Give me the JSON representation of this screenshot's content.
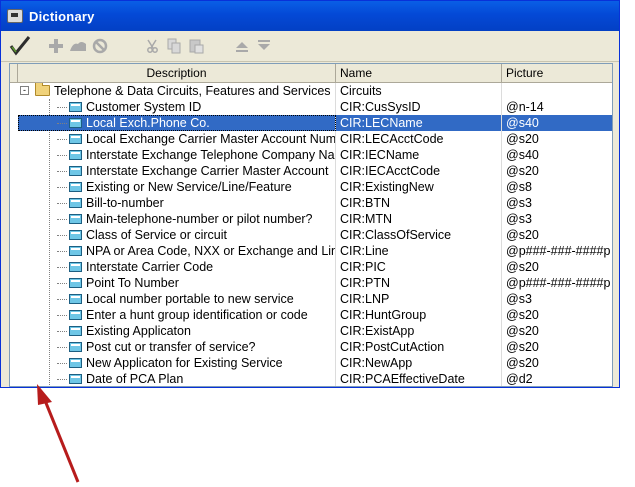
{
  "window": {
    "title": "Dictionary"
  },
  "toolbar": {
    "buttons": [
      {
        "icon": "checkmark-icon"
      },
      {
        "icon": "add-icon"
      },
      {
        "icon": "library-icon"
      },
      {
        "icon": "prohibit-icon"
      },
      {
        "icon": "cut-icon"
      },
      {
        "icon": "copy-icon"
      },
      {
        "icon": "paste-icon"
      },
      {
        "icon": "move-up-icon"
      },
      {
        "icon": "move-down-icon"
      }
    ]
  },
  "grid": {
    "columns": [
      "Description",
      "Name",
      "Picture"
    ],
    "root": {
      "description": "Telephone & Data Circuits, Features and Services",
      "name": "Circuits",
      "picture": "",
      "expander": "-"
    },
    "rows": [
      {
        "description": "Customer System ID",
        "name": "CIR:CusSysID",
        "picture": "@n-14"
      },
      {
        "description": "Local Exch.Phone Co.",
        "name": "CIR:LECName",
        "picture": "@s40"
      },
      {
        "description": "Local Exchange Carrier Master Account Number",
        "name": "CIR:LECAcctCode",
        "picture": "@s20"
      },
      {
        "description": "Interstate Exchange Telephone Company Name",
        "name": "CIR:IECName",
        "picture": "@s40"
      },
      {
        "description": "Interstate Exchange Carrier Master Account",
        "name": "CIR:IECAcctCode",
        "picture": "@s20"
      },
      {
        "description": "Existing or New Service/Line/Feature",
        "name": "CIR:ExistingNew",
        "picture": "@s8"
      },
      {
        "description": "Bill-to-number",
        "name": "CIR:BTN",
        "picture": "@s3"
      },
      {
        "description": "Main-telephone-number or pilot number?",
        "name": "CIR:MTN",
        "picture": "@s3"
      },
      {
        "description": "Class of Service or circuit",
        "name": "CIR:ClassOfService",
        "picture": "@s20"
      },
      {
        "description": "NPA or Area Code, NXX or Exchange and Line",
        "name": "CIR:Line",
        "picture": "@p###-###-####p"
      },
      {
        "description": "Interstate Carrier Code",
        "name": "CIR:PIC",
        "picture": "@s20"
      },
      {
        "description": "Point To Number",
        "name": "CIR:PTN",
        "picture": "@p###-###-####p"
      },
      {
        "description": "Local number portable to new service",
        "name": "CIR:LNP",
        "picture": "@s3"
      },
      {
        "description": "Enter a hunt group identification or code",
        "name": "CIR:HuntGroup",
        "picture": "@s20"
      },
      {
        "description": "Existing Applicaton",
        "name": "CIR:ExistApp",
        "picture": "@s20"
      },
      {
        "description": "Post cut or transfer of service?",
        "name": "CIR:PostCutAction",
        "picture": "@s20"
      },
      {
        "description": "New Applicaton for Existing Service",
        "name": "CIR:NewApp",
        "picture": "@s20"
      },
      {
        "description": "Date of PCA Plan",
        "name": "CIR:PCAEffectiveDate",
        "picture": "@d2"
      }
    ]
  },
  "colors": {
    "selection": "#316ac5",
    "titlebar": "#0449d6",
    "arrow": "#b71c1c"
  }
}
